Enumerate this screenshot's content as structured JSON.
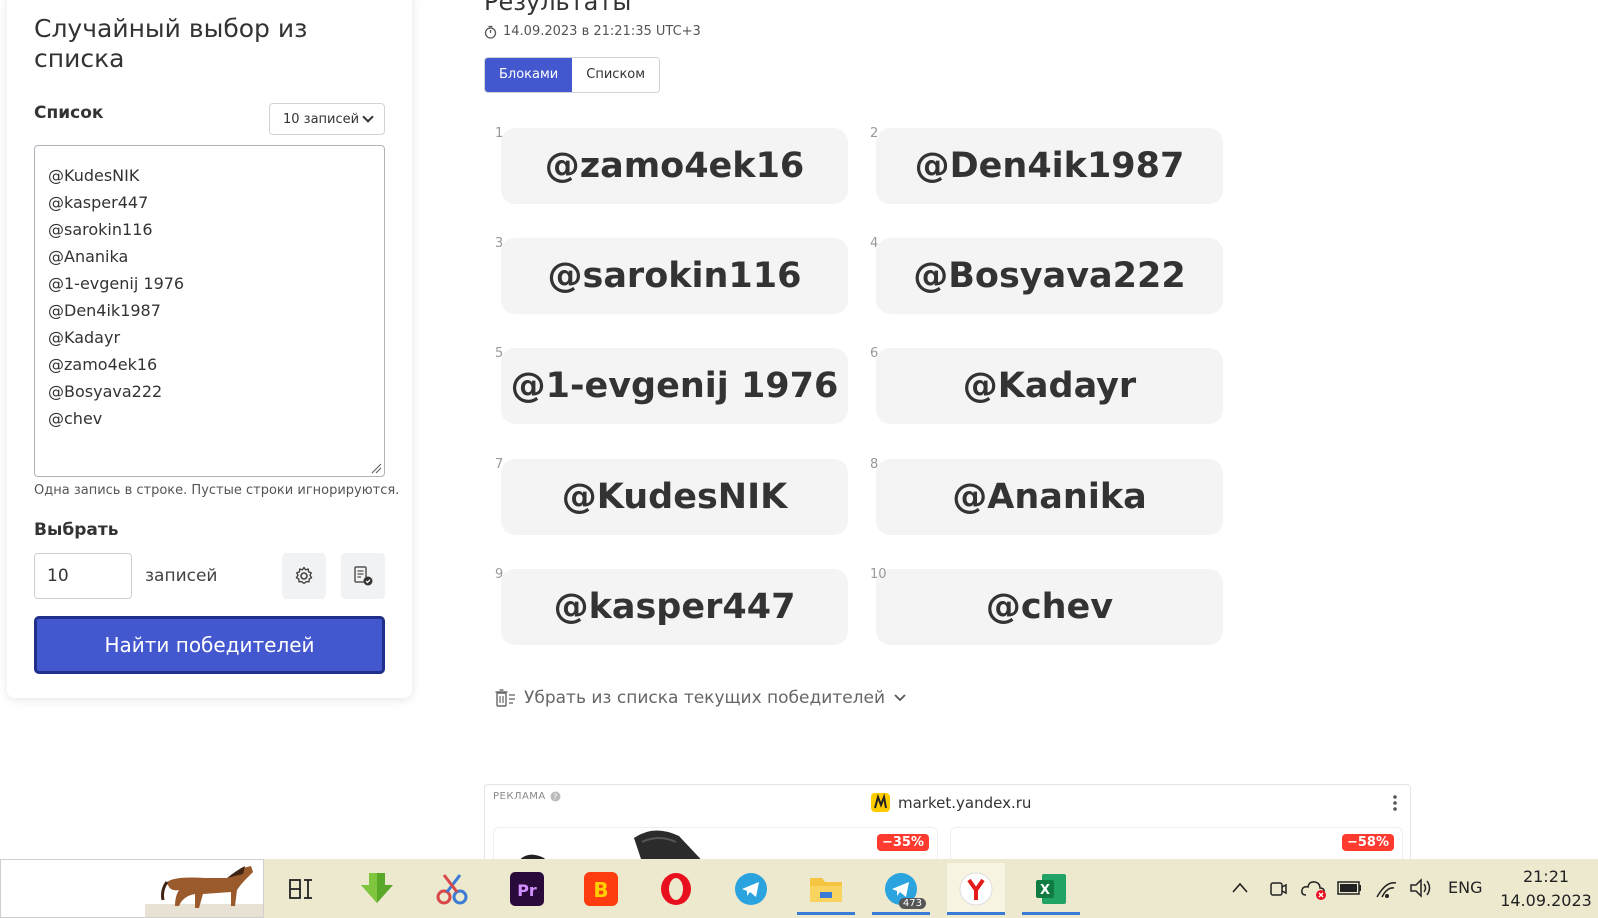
{
  "panel": {
    "title": "Случайный выбор из списка",
    "list_label": "Список",
    "count_select_value": "10 записей",
    "list_entries": [
      "@KudesNIK",
      "@kasper447",
      "@sarokin116",
      "@Ananika",
      "@1-evgenij 1976",
      "@Den4ik1987",
      "@Kadayr",
      "@zamo4ek16",
      "@Bosyava222",
      "@chev"
    ],
    "list_hint": "Одна запись в строке. Пустые строки игнорируются.",
    "pick_label": "Выбрать",
    "pick_count": "10",
    "records_label": "записей",
    "find_button": "Найти победителей"
  },
  "results": {
    "title": "Результаты",
    "timestamp": "14.09.2023 в 21:21:35 UTC+3",
    "view_blocks": "Блоками",
    "view_list": "Списком",
    "winners": [
      {
        "num": "1",
        "name": "@zamo4ek16"
      },
      {
        "num": "2",
        "name": "@Den4ik1987"
      },
      {
        "num": "3",
        "name": "@sarokin116"
      },
      {
        "num": "4",
        "name": "@Bosyava222"
      },
      {
        "num": "5",
        "name": "@1-evgenij 1976"
      },
      {
        "num": "6",
        "name": "@Kadayr"
      },
      {
        "num": "7",
        "name": "@KudesNIK"
      },
      {
        "num": "8",
        "name": "@Ananika"
      },
      {
        "num": "9",
        "name": "@kasper447"
      },
      {
        "num": "10",
        "name": "@chev"
      }
    ],
    "remove_label": "Убрать из списка текущих победителей"
  },
  "ad": {
    "tag": "РЕКЛАМА",
    "domain": "market.yandex.ru",
    "discount_1": "−35%",
    "discount_2": "−58%"
  },
  "taskbar": {
    "apps": [
      "task-view-icon",
      "download-manager-icon",
      "snipping-tool-icon",
      "premiere-pro-icon",
      "brave-icon",
      "opera-icon",
      "telegram-icon",
      "file-explorer-icon",
      "telegram-icon",
      "yandex-browser-icon",
      "excel-icon"
    ],
    "telegram_badge": "473",
    "language": "ENG",
    "time": "21:21",
    "date": "14.09.2023"
  },
  "colors": {
    "accent": "#4358cf",
    "card_bg": "#f4f4f4",
    "taskbar_bg": "#ece9cf",
    "discount": "#ff3b30"
  }
}
